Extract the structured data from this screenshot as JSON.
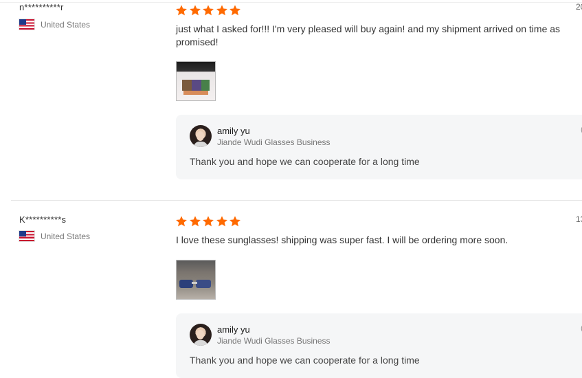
{
  "colors": {
    "star": "#ff6a00",
    "reply_bg": "#f5f6f7"
  },
  "reviews": [
    {
      "name": "n**********r",
      "country": "United States",
      "flag_icon": "us-flag-icon",
      "date_fragment": "20",
      "rating": 5,
      "text": "just what I asked for!!! I'm very pleased will buy again! and my shipment arrived on time as promised!",
      "reply": {
        "name": "amily yu",
        "shop": "Jiande Wudi Glasses Business",
        "text": "Thank you and hope we can cooperate for a long time",
        "edge_fragment": "("
      }
    },
    {
      "name": "K**********s",
      "country": "United States",
      "flag_icon": "us-flag-icon",
      "date_fragment": "13",
      "rating": 5,
      "text": "I love these sunglasses! shipping was super fast. I will be ordering more soon.",
      "reply": {
        "name": "amily yu",
        "shop": "Jiande Wudi Glasses Business",
        "text": "Thank you and hope we can cooperate for a long time",
        "edge_fragment": "("
      }
    }
  ]
}
